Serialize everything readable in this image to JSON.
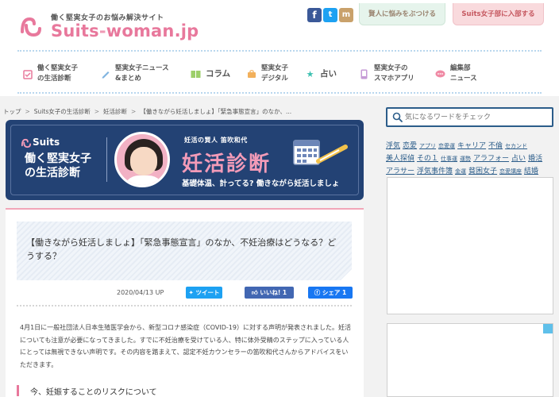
{
  "header": {
    "logo_tagline": "働く堅実女子のお悩み解決サイト",
    "logo_name": "Suits",
    "logo_dash": "-",
    "logo_domain": "woman.jp",
    "social": [
      {
        "name": "facebook",
        "glyph": "f"
      },
      {
        "name": "twitter",
        "glyph": "t"
      },
      {
        "name": "line",
        "glyph": "m"
      }
    ],
    "ask_button": "賢人に悩みをぶつける",
    "join_button": "Suits女子部に入部する"
  },
  "nav": [
    {
      "label": "働く堅実女子\nの生活診断",
      "icon": "clipboard-icon",
      "color": "#e8789c"
    },
    {
      "label": "堅実女子ニュース\n&まとめ",
      "icon": "pencil-icon",
      "color": "#7fb3e0"
    },
    {
      "label": "コラム",
      "icon": "book-icon",
      "color": "#9dcf6a"
    },
    {
      "label": "堅実女子\nデジタル",
      "icon": "bag-icon",
      "color": "#f2b05b"
    },
    {
      "label": "占い",
      "icon": "star-icon",
      "color": "#3cc0b0"
    },
    {
      "label": "堅実女子の\nスマホアプリ",
      "icon": "phone-icon",
      "color": "#c59ad6"
    },
    {
      "label": "編集部\nニュース",
      "icon": "chat-icon",
      "color": "#f08aa5"
    }
  ],
  "breadcrumb": [
    "トップ",
    "Suits女子の生活診断",
    "妊活診断",
    "【働きながら妊活しましょ】「緊急事態宣言」のなか、..."
  ],
  "banner": {
    "brand": "Suits",
    "subtitle": "働く堅実女子\nの生活診断",
    "kicker": "妊活の賢人 笛吹和代",
    "title": "妊活診断",
    "caption": "基礎体温、計ってる? 働きながら妊活しましょ"
  },
  "article": {
    "title": "【働きながら妊活しましょ】「緊急事態宣言」のなか、不妊治療はどうなる？どうする？",
    "date": "2020/04/13 UP",
    "tweet_label": "ツイート",
    "like_label": "いいね! 1",
    "share_label": "シェア 1",
    "body": "4月1日に一般社団法人日本生殖医学会から、新型コロナ感染症（COVID-19）に対する声明が発表されました。妊活についても注意が必要になってきました。すでに不妊治療を受けている人、特に体外受精のステップに入っている人にとっては無視できない声明です。その内容を踏まえて、認定不妊カウンセラーの笛吹和代さんからアドバイスをいただきます。",
    "section_title": "今、妊娠することのリスクについて"
  },
  "sidebar": {
    "search_placeholder": "気になるワードをチェック",
    "tags": [
      {
        "text": "浮気",
        "small": false
      },
      {
        "text": "恋愛",
        "small": false
      },
      {
        "text": "アプリ",
        "small": true
      },
      {
        "text": "恋愛運",
        "small": true
      },
      {
        "text": "キャリア",
        "small": false
      },
      {
        "text": "不倫",
        "small": false
      },
      {
        "text": "セカンド",
        "small": true
      },
      {
        "text": "美人探偵",
        "small": false
      },
      {
        "text": "その１",
        "small": false
      },
      {
        "text": "仕事運",
        "small": true
      },
      {
        "text": "運勢",
        "small": true
      },
      {
        "text": "アラフォー",
        "small": false
      },
      {
        "text": "占い",
        "small": false
      },
      {
        "text": "婚活",
        "small": false
      },
      {
        "text": "アラサー",
        "small": false
      },
      {
        "text": "浮気事件簿",
        "small": false
      },
      {
        "text": "金運",
        "small": true
      },
      {
        "text": "貧困女子",
        "small": false
      },
      {
        "text": "恋愛講座",
        "small": true
      },
      {
        "text": "結婚",
        "small": false
      }
    ]
  },
  "colors": {
    "brand_pink": "#e8789c",
    "banner_navy": "#234274",
    "link_blue": "#2c5d8a"
  }
}
